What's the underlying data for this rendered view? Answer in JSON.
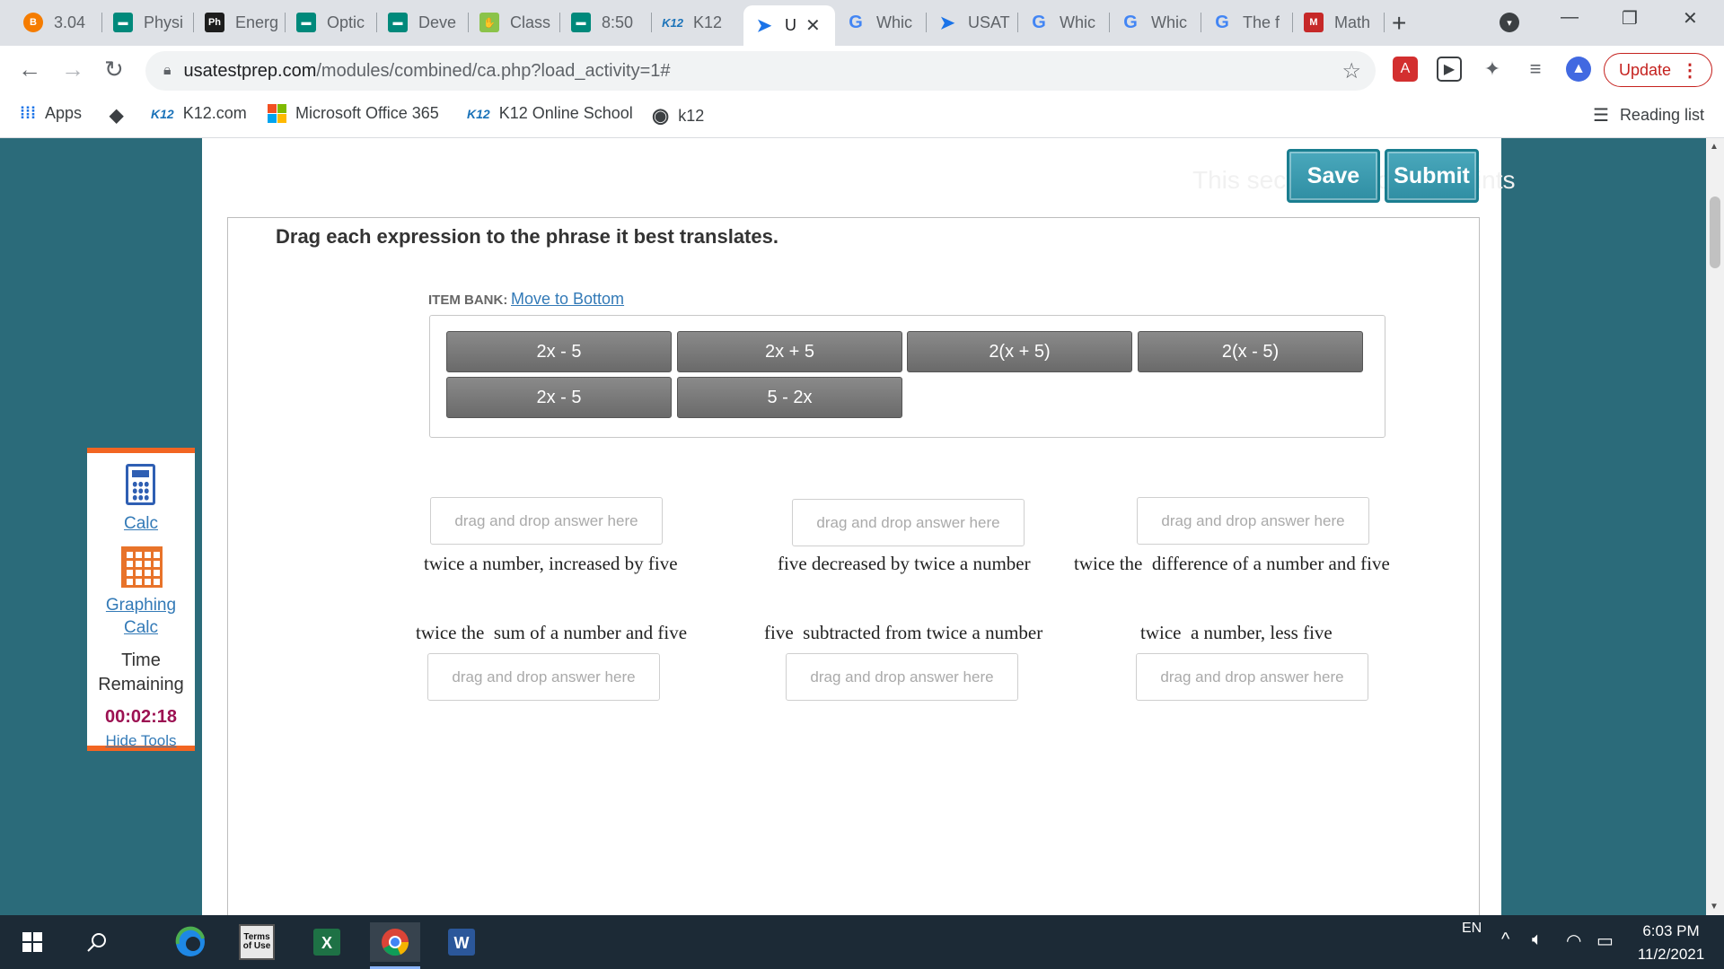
{
  "browser": {
    "tabs": [
      {
        "title": "3.04",
        "favicon": "b-circle-icon"
      },
      {
        "title": "Physi",
        "favicon": "doc-icon"
      },
      {
        "title": "Energ",
        "favicon": "phet-icon"
      },
      {
        "title": "Optic",
        "favicon": "doc-icon"
      },
      {
        "title": "Deve",
        "favicon": "doc-icon"
      },
      {
        "title": "Class",
        "favicon": "classkick-icon"
      },
      {
        "title": "8:50",
        "favicon": "doc-icon"
      },
      {
        "title": "K12",
        "favicon": "k12-icon"
      },
      {
        "title": "U",
        "favicon": "cursor-icon",
        "active": true
      },
      {
        "title": "Whic",
        "favicon": "google-icon"
      },
      {
        "title": "USAT",
        "favicon": "cursor-icon"
      },
      {
        "title": "Whic",
        "favicon": "google-icon"
      },
      {
        "title": "Whic",
        "favicon": "google-icon"
      },
      {
        "title": "The f",
        "favicon": "google-icon"
      },
      {
        "title": "Math",
        "favicon": "m-icon"
      }
    ],
    "url": {
      "host": "usatestprep.com",
      "path": "/modules/combined/ca.php?load_activity=1#"
    },
    "update_label": "Update",
    "bookmarks": [
      {
        "label": "Apps",
        "icon": "apps-grid-icon"
      },
      {
        "label": "",
        "icon": "roblox-icon"
      },
      {
        "label": "K12.com",
        "icon": "k12-icon"
      },
      {
        "label": "Microsoft Office 365",
        "icon": "office-icon"
      },
      {
        "label": "K12 Online School",
        "icon": "k12-icon"
      },
      {
        "label": "k12",
        "icon": "globe-icon"
      }
    ],
    "reading_list": "Reading list"
  },
  "page": {
    "section_note": "This section is worth 6 points",
    "save_label": "Save",
    "submit_label": "Submit",
    "instruction": "Drag each expression to the phrase it best translates.",
    "item_bank_label": "ITEM BANK:",
    "item_bank_move": "Move to Bottom",
    "item_bank": [
      "2x - 5",
      "2x + 5",
      "2(x + 5)",
      "2(x - 5)",
      "2x - 5",
      "5 - 2x"
    ],
    "drop_placeholder": "drag and drop answer here",
    "phrases": [
      "twice a number, increased by five",
      "five decreased by twice a number",
      "twice the  difference of a number and five",
      "twice the  sum of a number and five",
      "five  subtracted from twice a number",
      "twice  a number, less five"
    ]
  },
  "tools": {
    "calc_label": "Calc",
    "graphing_calc_line1": "Graphing",
    "graphing_calc_line2": "Calc",
    "time_label_line1": "Time",
    "time_label_line2": "Remaining",
    "time_remaining": "00:02:18",
    "hide_tools": "Hide Tools"
  },
  "taskbar": {
    "apps": [
      "start-icon",
      "search-icon",
      "edge-icon",
      "terms-of-use-icon",
      "excel-icon",
      "chrome-icon",
      "word-icon"
    ],
    "terms_icon_text": "Terms of Use",
    "language": "EN",
    "time": "6:03 PM",
    "date": "11/2/2021"
  },
  "colors": {
    "page_bg": "#2b6b7a",
    "accent_button": "#2f8ea3",
    "tools_border": "#f26522",
    "timer": "#9c1152"
  }
}
